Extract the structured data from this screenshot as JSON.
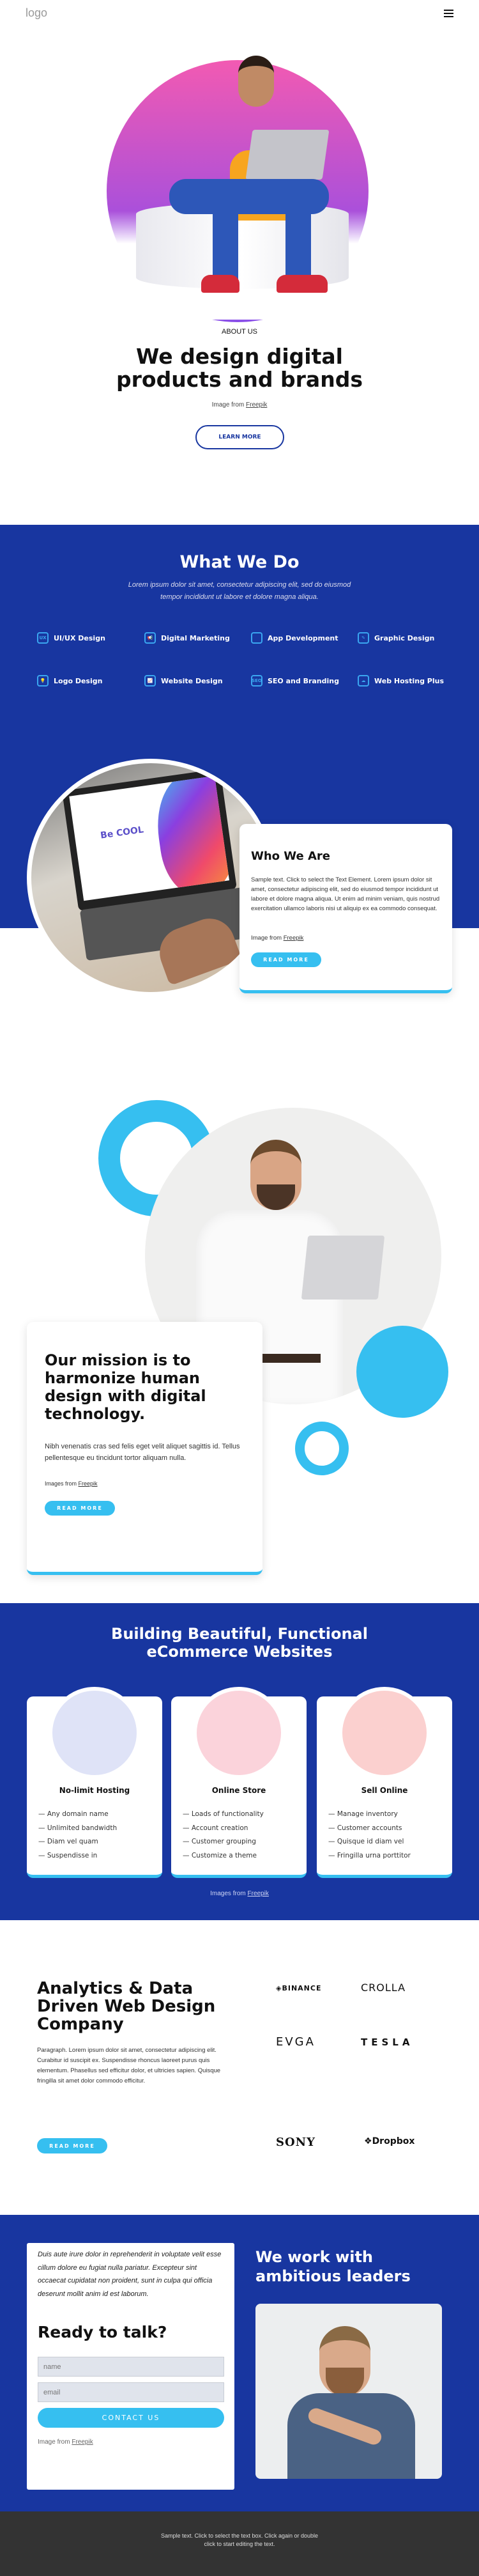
{
  "header": {
    "logo": "logo",
    "menu_icon": "hamburger-icon"
  },
  "hero": {
    "eyebrow": "ABOUT US",
    "title_line1": "We design digital",
    "title_line2": "products and brands",
    "credit_prefix": "Image from",
    "credit_link": "Freepik",
    "button": "LEARN MORE"
  },
  "what_we_do": {
    "title": "What We Do",
    "subtitle_line1": "Lorem ipsum dolor sit amet, consectetur adipiscing elit, sed do eiusmod",
    "subtitle_line2": "tempor incididunt ut labore et dolore magna aliqua.",
    "services": [
      {
        "label": "UI/UX Design",
        "icon": "ux-icon"
      },
      {
        "label": "Digital Marketing",
        "icon": "megaphone-icon"
      },
      {
        "label": "App Development",
        "icon": "phone-code-icon"
      },
      {
        "label": "Graphic Design",
        "icon": "document-pen-icon"
      },
      {
        "label": "Logo Design",
        "icon": "lightbulb-icon"
      },
      {
        "label": "Website Design",
        "icon": "monitor-chart-icon"
      },
      {
        "label": "SEO and Branding",
        "icon": "seo-search-icon"
      },
      {
        "label": "Web Hosting Plus",
        "icon": "cloud-network-icon"
      }
    ]
  },
  "who": {
    "laptop_screen_text": "Be COOL",
    "title": "Who We Are",
    "body": "Sample text. Click to select the Text Element. Lorem ipsum dolor sit amet, consectetur adipiscing elit, sed do eiusmod tempor incididunt ut labore et dolore magna aliqua. Ut enim ad minim veniam, quis nostrud exercitation ullamco laboris nisi ut aliquip ex ea commodo consequat.",
    "credit_prefix": "Image from",
    "credit_link": "Freepik",
    "button": "READ MORE"
  },
  "mission": {
    "title": "Our mission is to harmonize human design with digital technology.",
    "body": "Nibh venenatis cras sed felis eget velit aliquet sagittis id. Tellus pellentesque eu tincidunt tortor aliquam nulla.",
    "credit_prefix": "Images from",
    "credit_link": "Freepik",
    "button": "READ MORE"
  },
  "ecommerce": {
    "title_line1": "Building Beautiful, Functional",
    "title_line2": "eCommerce Websites",
    "cards": [
      {
        "title": "No-limit Hosting",
        "items": [
          "Any domain name",
          "Unlimited bandwidth",
          "Diam vel quam",
          "Suspendisse in"
        ],
        "color": "#dfe3f7"
      },
      {
        "title": "Online Store",
        "items": [
          "Loads of functionality",
          "Account creation",
          "Customer grouping",
          "Customize a theme"
        ],
        "color": "#fbd3db"
      },
      {
        "title": "Sell Online",
        "items": [
          "Manage inventory",
          "Customer accounts",
          "Quisque id diam vel",
          "Fringilla urna porttitor"
        ],
        "color": "#fbd0cf"
      }
    ],
    "credit_prefix": "Images from",
    "credit_link": "Freepik"
  },
  "analytics": {
    "title": "Analytics & Data Driven Web Design Company",
    "body": "Paragraph. Lorem ipsum dolor sit amet, consectetur adipiscing elit. Curabitur id suscipit ex. Suspendisse rhoncus laoreet purus quis elementum. Phasellus sed efficitur dolor, et ultricies sapien. Quisque fringilla sit amet dolor commodo efficitur.",
    "button": "READ MORE",
    "logos": [
      "BINANCE",
      "CROLLA",
      "EVGA",
      "TESLA",
      "SONY",
      "Dropbox"
    ]
  },
  "contact": {
    "quote": "Duis aute irure dolor in reprehenderit in voluptate velit esse cillum dolore eu fugiat nulla pariatur. Excepteur sint occaecat cupidatat non proident, sunt in culpa qui officia deserunt mollit anim id est laborum.",
    "title": "Ready to talk?",
    "name_placeholder": "name",
    "email_placeholder": "email",
    "button": "CONTACT US",
    "credit_prefix": "Image from",
    "credit_link": "Freepik",
    "right_title": "We work with ambitious leaders"
  },
  "footer": {
    "text_line1": "Sample text. Click to select the text box. Click again or double",
    "text_line2": "click to start editing the text."
  },
  "colors": {
    "primary_blue": "#1836a0",
    "accent": "#36bff0",
    "footer": "#333333"
  }
}
